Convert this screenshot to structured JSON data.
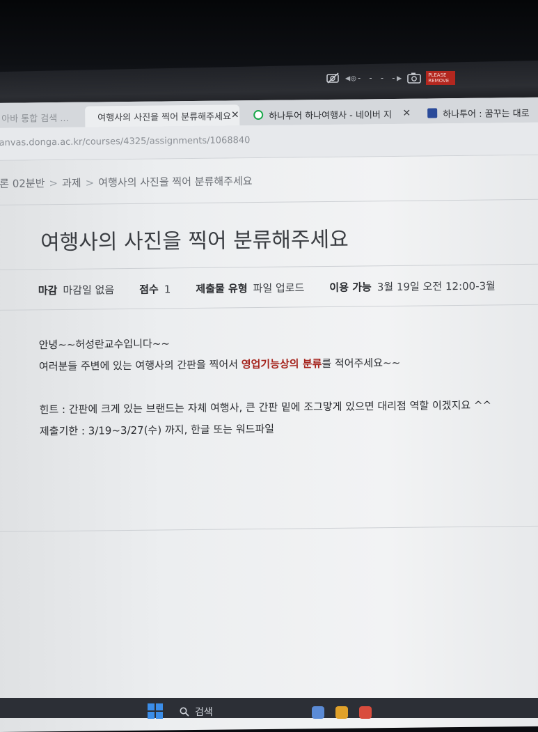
{
  "camera_bar": {
    "dashes": "◀◎- - - -▶",
    "sticker_text": "PLEASE REMOVE"
  },
  "tabs": [
    {
      "label": "ㅇ아바 통합 검색 ..."
    },
    {
      "label": "여행사의 사진을 찍어 분류해주세요",
      "close": "✕"
    },
    {
      "label": "하나투어 하나여행사 - 네이버 지",
      "close": "✕"
    },
    {
      "label": "하나투어 : 꿈꾸는 대로"
    }
  ],
  "address": "anvas.donga.ac.kr/courses/4325/assignments/1068840",
  "breadcrumb": [
    "론 02분반",
    "과제",
    "여행사의 사진을 찍어 분류해주세요"
  ],
  "breadcrumb_sep": ">",
  "page_title": "여행사의 사진을 찍어 분류해주세요",
  "meta": {
    "due_label": "마감",
    "due_value": "마감일 없음",
    "points_label": "점수",
    "points_value": "1",
    "submission_label": "제출물 유형",
    "submission_value": "파일 업로드",
    "available_label": "이용 가능",
    "available_value": "3월 19일 오전 12:00-3월"
  },
  "body": {
    "line1": "안녕~~허성란교수입니다~~",
    "line2_pre": "여러분들 주변에 있는 여행사의 간판을 찍어서 ",
    "line2_highlight": "영업기능상의 분류",
    "line2_post": "를 적어주세요~~",
    "line3": "힌트 : 간판에 크게 있는 브랜드는 자체 여행사, 큰 간판 밑에 조그맣게 있으면 대리점 역할 이겠지요 ^^",
    "line4": "제출기한 : 3/19~3/27(수) 까지, 한글 또는 워드파일"
  },
  "taskbar": {
    "search_label": "검색"
  },
  "colors": {
    "highlight": "#a5231c",
    "win_blue": "#3b8de8"
  }
}
